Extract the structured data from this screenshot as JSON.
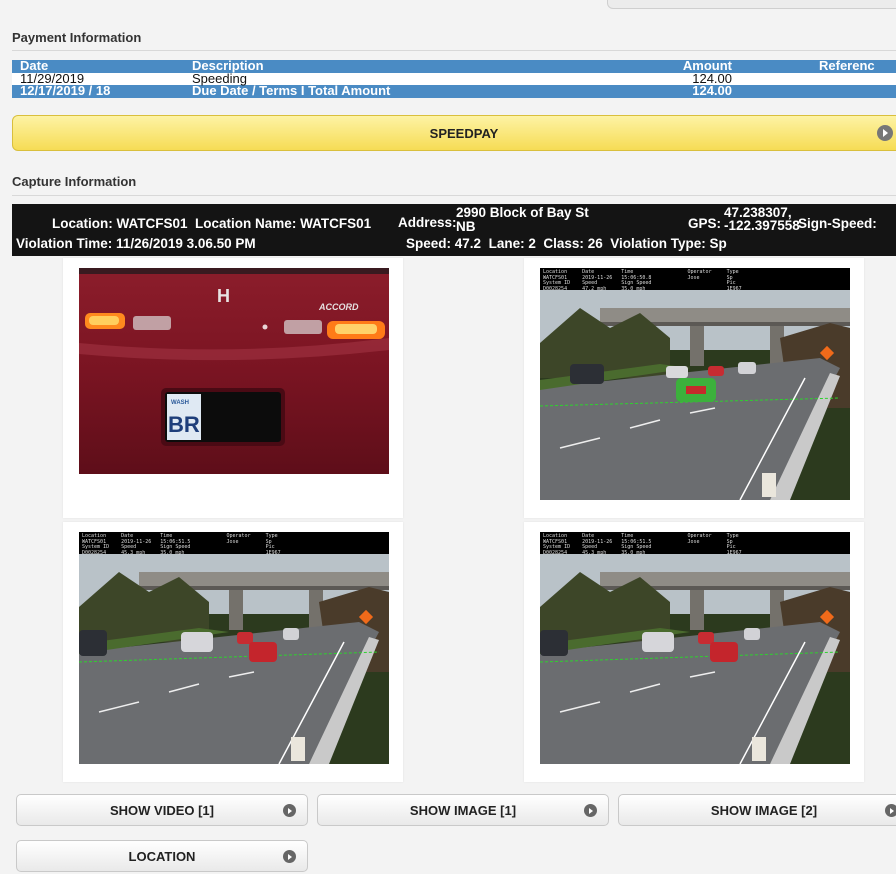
{
  "payment": {
    "title": "Payment Information",
    "columns": {
      "date": "Date",
      "description": "Description",
      "amount": "Amount",
      "reference": "Referenc"
    },
    "rows": [
      {
        "date": "11/29/2019",
        "description": "Speeding",
        "amount": "124.00"
      }
    ],
    "total": {
      "date": "12/17/2019 / 18",
      "description": "Due Date / Terms I Total Amount",
      "amount": "124.00"
    },
    "speedpay_label": "SPEEDPAY"
  },
  "capture": {
    "title": "Capture Information",
    "location_label": "Location:",
    "location": "WATCFS01",
    "location_name_label": "Location Name:",
    "location_name": "WATCFS01",
    "address_label": "Address:",
    "address_line1": "2990 Block of Bay St",
    "address_line2": "NB",
    "gps_label": "GPS:",
    "gps_lat": "47.238307,",
    "gps_lon": "-122.397558",
    "sign_speed_label": "Sign-Speed:",
    "violation_time_label": "Violation Time:",
    "violation_time": "11/26/2019 3.06.50 PM",
    "speed_label": "Speed:",
    "speed": "47.2",
    "lane_label": "Lane:",
    "lane": "2",
    "class_label": "Class:",
    "class": "26",
    "violation_type_label": "Violation Type:",
    "violation_type": "Sp"
  },
  "images": {
    "plate_badge": "WASH",
    "plate_text": "BR",
    "car_model": "ACCORD",
    "overlay_a": "Location     Date         Time                  Operator     Type\nWATCFS01     2019-11-26   15:06:50.8            Jose         Sp\nSystem ID    Speed        Sign Speed                         Pic\nD0028254     47.2 mph     35.0 mph                           1E967",
    "overlay_b": "Location     Date         Time                  Operator     Type\nWATCFS01     2019-11-26   15:06:51.5            Jose         Sp\nSystem ID    Speed        Sign Speed                         Pic\nD0028254     45.3 mph     35.0 mph                           1E967"
  },
  "buttons": {
    "show_video": "SHOW VIDEO [1]",
    "show_image_1": "SHOW IMAGE [1]",
    "show_image_2": "SHOW IMAGE [2]",
    "location": "LOCATION"
  },
  "colors": {
    "table_header": "#4a8bc4",
    "speedpay": "#f6dc55",
    "capture_bar": "#141414"
  }
}
